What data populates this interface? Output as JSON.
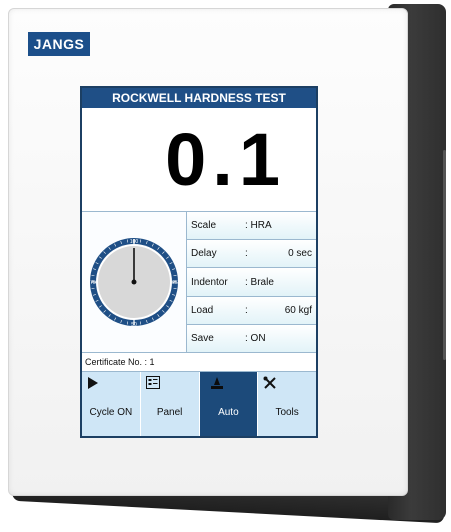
{
  "brand": "JANGS",
  "screen": {
    "title": "ROCKWELL HARDNESS TEST",
    "reading": "0.1",
    "gauge": {
      "ticks": [
        "100",
        "25",
        "50",
        "75"
      ],
      "needle_value": 0
    },
    "params": [
      {
        "label": "Scale",
        "sep": ": HRA",
        "value": ""
      },
      {
        "label": "Delay",
        "sep": ":",
        "value": "0 sec"
      },
      {
        "label": "Indentor",
        "sep": ": Brale",
        "value": ""
      },
      {
        "label": "Load",
        "sep": ":",
        "value": "60 kgf"
      },
      {
        "label": "Save",
        "sep": ": ON",
        "value": ""
      }
    ],
    "certificate": "Certificate No. : 1",
    "buttons": [
      {
        "label": "Cycle ON",
        "icon": "play-icon",
        "active": false
      },
      {
        "label": "Panel",
        "icon": "panel-icon",
        "active": false
      },
      {
        "label": "Auto",
        "icon": "auto-icon",
        "active": true
      },
      {
        "label": "Tools",
        "icon": "tools-icon",
        "active": false
      }
    ]
  },
  "colors": {
    "title_bar": "#1f4f86",
    "active_button": "#1c4a7a",
    "button": "#cfe6f6",
    "housing": "#2f2f2f"
  }
}
